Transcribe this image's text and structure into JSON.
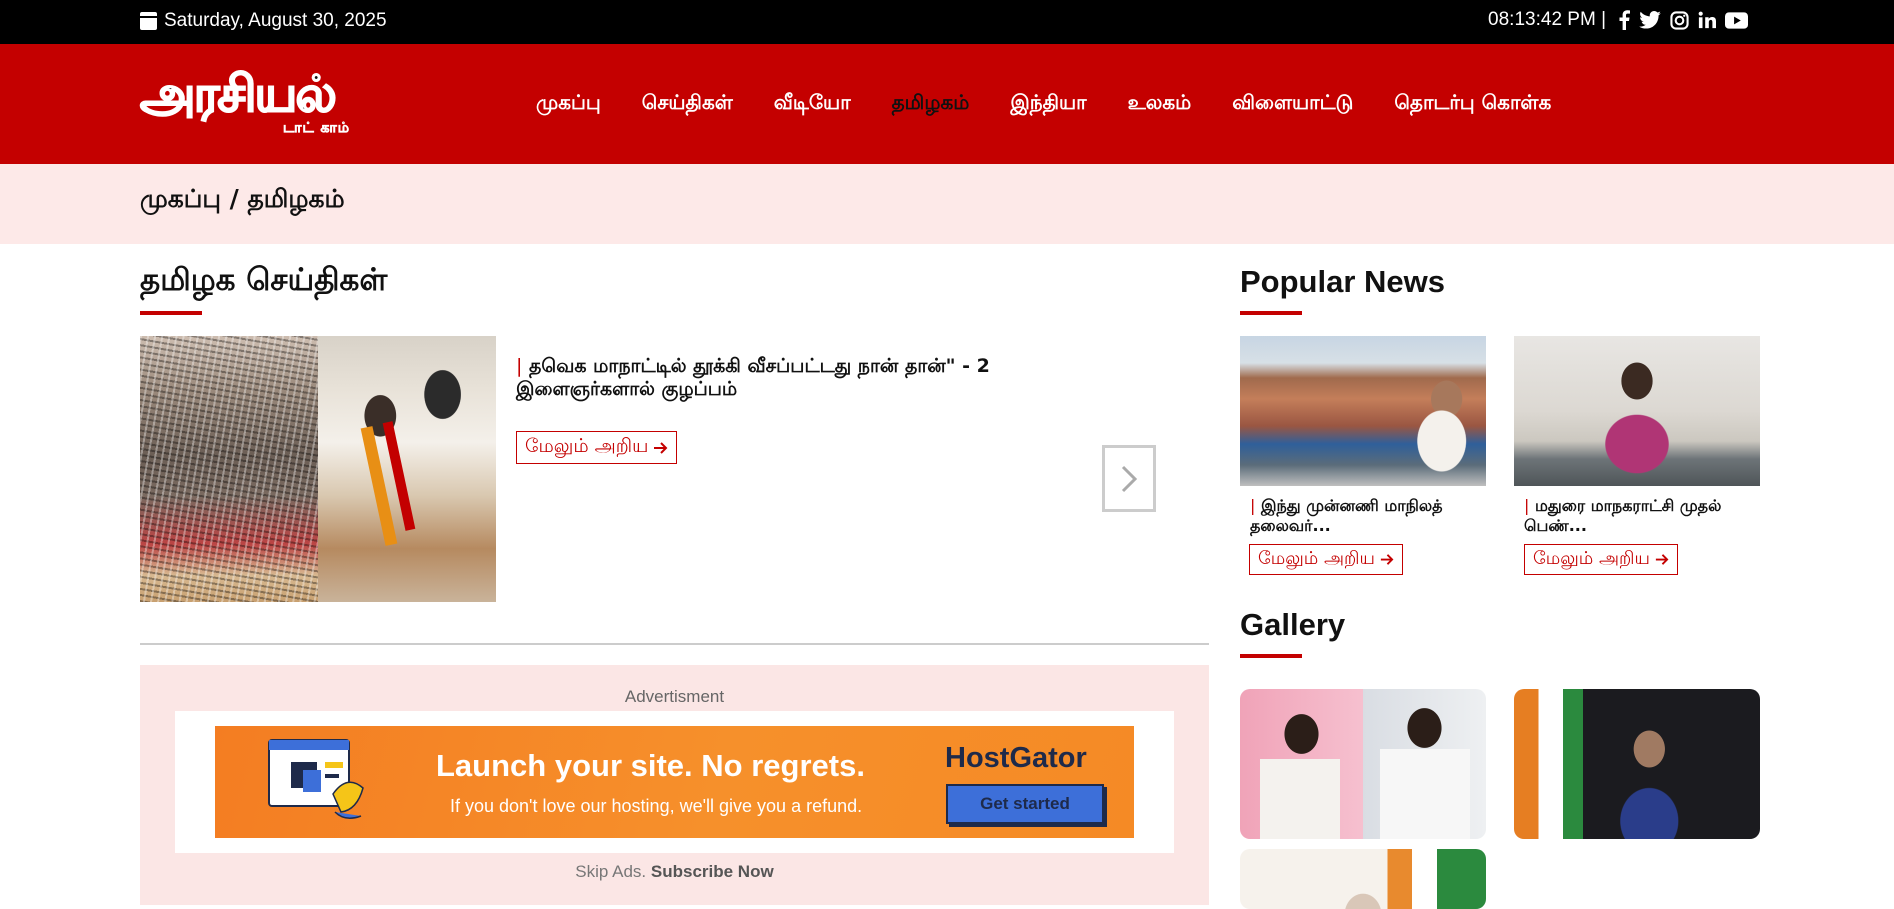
{
  "topbar": {
    "date": "Saturday, August 30, 2025",
    "time": "08:13:42 PM |",
    "social_icons": [
      "facebook-icon",
      "twitter-icon",
      "instagram-icon",
      "linkedin-icon",
      "youtube-icon"
    ]
  },
  "brand": {
    "logo_main": "அரசியல்",
    "logo_sub": "டாட் காம்"
  },
  "nav": {
    "items": [
      {
        "label": "முகப்பு"
      },
      {
        "label": "செய்திகள்"
      },
      {
        "label": "வீடியோ"
      },
      {
        "label": "தமிழகம்"
      },
      {
        "label": "இந்தியா"
      },
      {
        "label": "உலகம்"
      },
      {
        "label": "விளையாட்டு"
      },
      {
        "label": "தொடர்பு கொள்க"
      }
    ]
  },
  "breadcrumb": "முகப்பு / தமிழகம்",
  "main": {
    "section_title": "தமிழக செய்திகள்",
    "featured": {
      "title": "தவெக மாநாட்டில் தூக்கி வீசப்பட்டது நான் தான்\" - 2 இளைஞர்களால் குழப்பம்",
      "more_label": "மேலும் அறிய"
    }
  },
  "advert": {
    "label": "Advertisment",
    "headline": "Launch your site. No regrets.",
    "subline": "If you don't love our hosting, we'll give you a refund.",
    "brand": "HostGator",
    "cta": "Get started",
    "skip_prefix": "Skip Ads.",
    "skip_link": "Subscribe Now"
  },
  "sidebar": {
    "popular_title": "Popular News",
    "popular": [
      {
        "title": "இந்து முன்னணி மாநிலத் தலைவர்...",
        "more_label": "மேலும் அறிய"
      },
      {
        "title": "மதுரை மாநகராட்சி முதல் பெண்...",
        "more_label": "மேலும் அறிய"
      }
    ],
    "gallery_title": "Gallery"
  },
  "colors": {
    "brand_red": "#c40000",
    "breadcrumb_bg": "#fde9e8",
    "advert_bg": "#fbe6e5"
  }
}
